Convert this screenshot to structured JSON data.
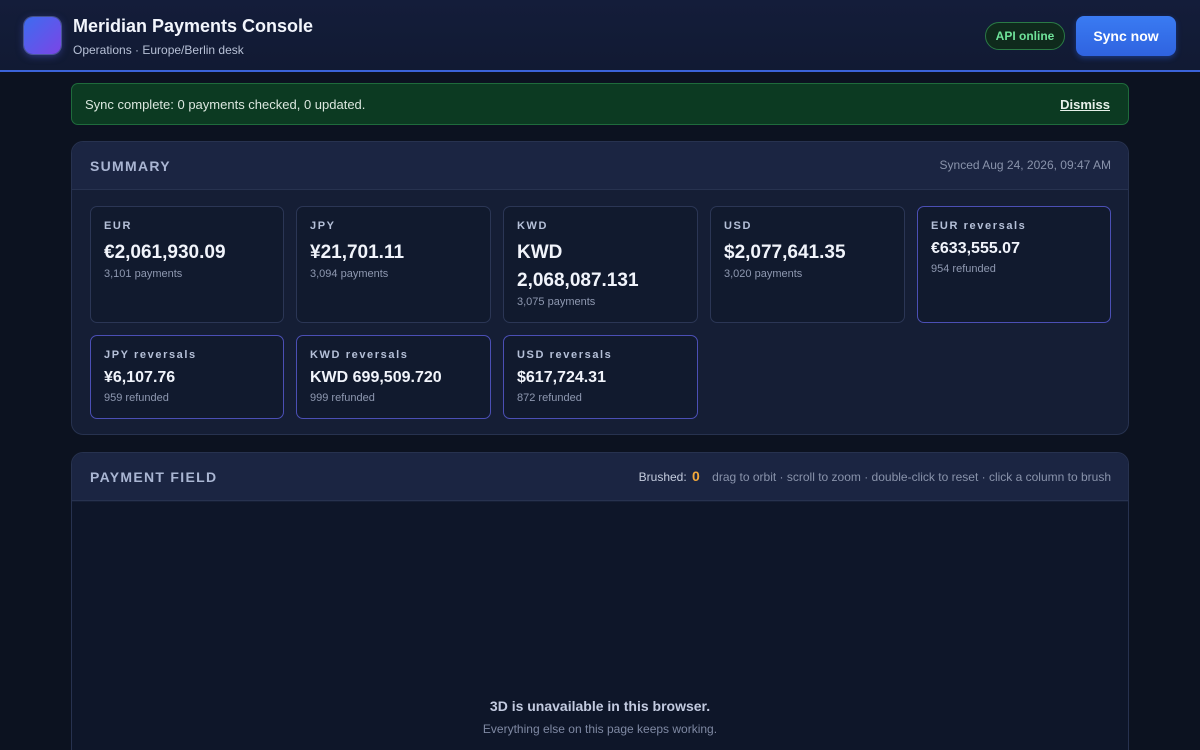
{
  "header": {
    "title": "Meridian Payments Console",
    "subtitle": "Operations · Europe/Berlin desk",
    "api_status": "API online",
    "sync_button": "Sync now",
    "colors": {
      "accent": "#3a7bf2",
      "status_ok": "#6fe39a"
    }
  },
  "alert": {
    "message": "Sync complete: 0 payments checked, 0 updated.",
    "dismiss": "Dismiss"
  },
  "summary": {
    "title": "SUMMARY",
    "synced": "Synced Aug 24, 2026, 09:47 AM",
    "cards": [
      {
        "label": "EUR",
        "amount": "€2,061,930.09",
        "sub": "3,101 payments"
      },
      {
        "label": "JPY",
        "amount": "¥21,701.11",
        "sub": "3,094 payments"
      },
      {
        "label": "KWD",
        "amount": "KWD 2,068,087.131",
        "sub": "3,075 payments"
      },
      {
        "label": "USD",
        "amount": "$2,077,641.35",
        "sub": "3,020 payments"
      },
      {
        "label": "EUR reversals",
        "amount": "€633,555.07",
        "sub": "954 refunded"
      },
      {
        "label": "JPY reversals",
        "amount": "¥6,107.76",
        "sub": "959 refunded"
      },
      {
        "label": "KWD reversals",
        "amount": "KWD 699,509.720",
        "sub": "999 refunded"
      },
      {
        "label": "USD reversals",
        "amount": "$617,724.31",
        "sub": "872 refunded"
      }
    ]
  },
  "field": {
    "title": "PAYMENT FIELD",
    "brushed_label": "Brushed:",
    "brushed_count": "0",
    "hint": "drag to orbit · scroll to zoom · double-click to reset · click a column to brush",
    "unavailable_title": "3D is unavailable in this browser.",
    "unavailable_sub": "Everything else on this page keeps working."
  }
}
